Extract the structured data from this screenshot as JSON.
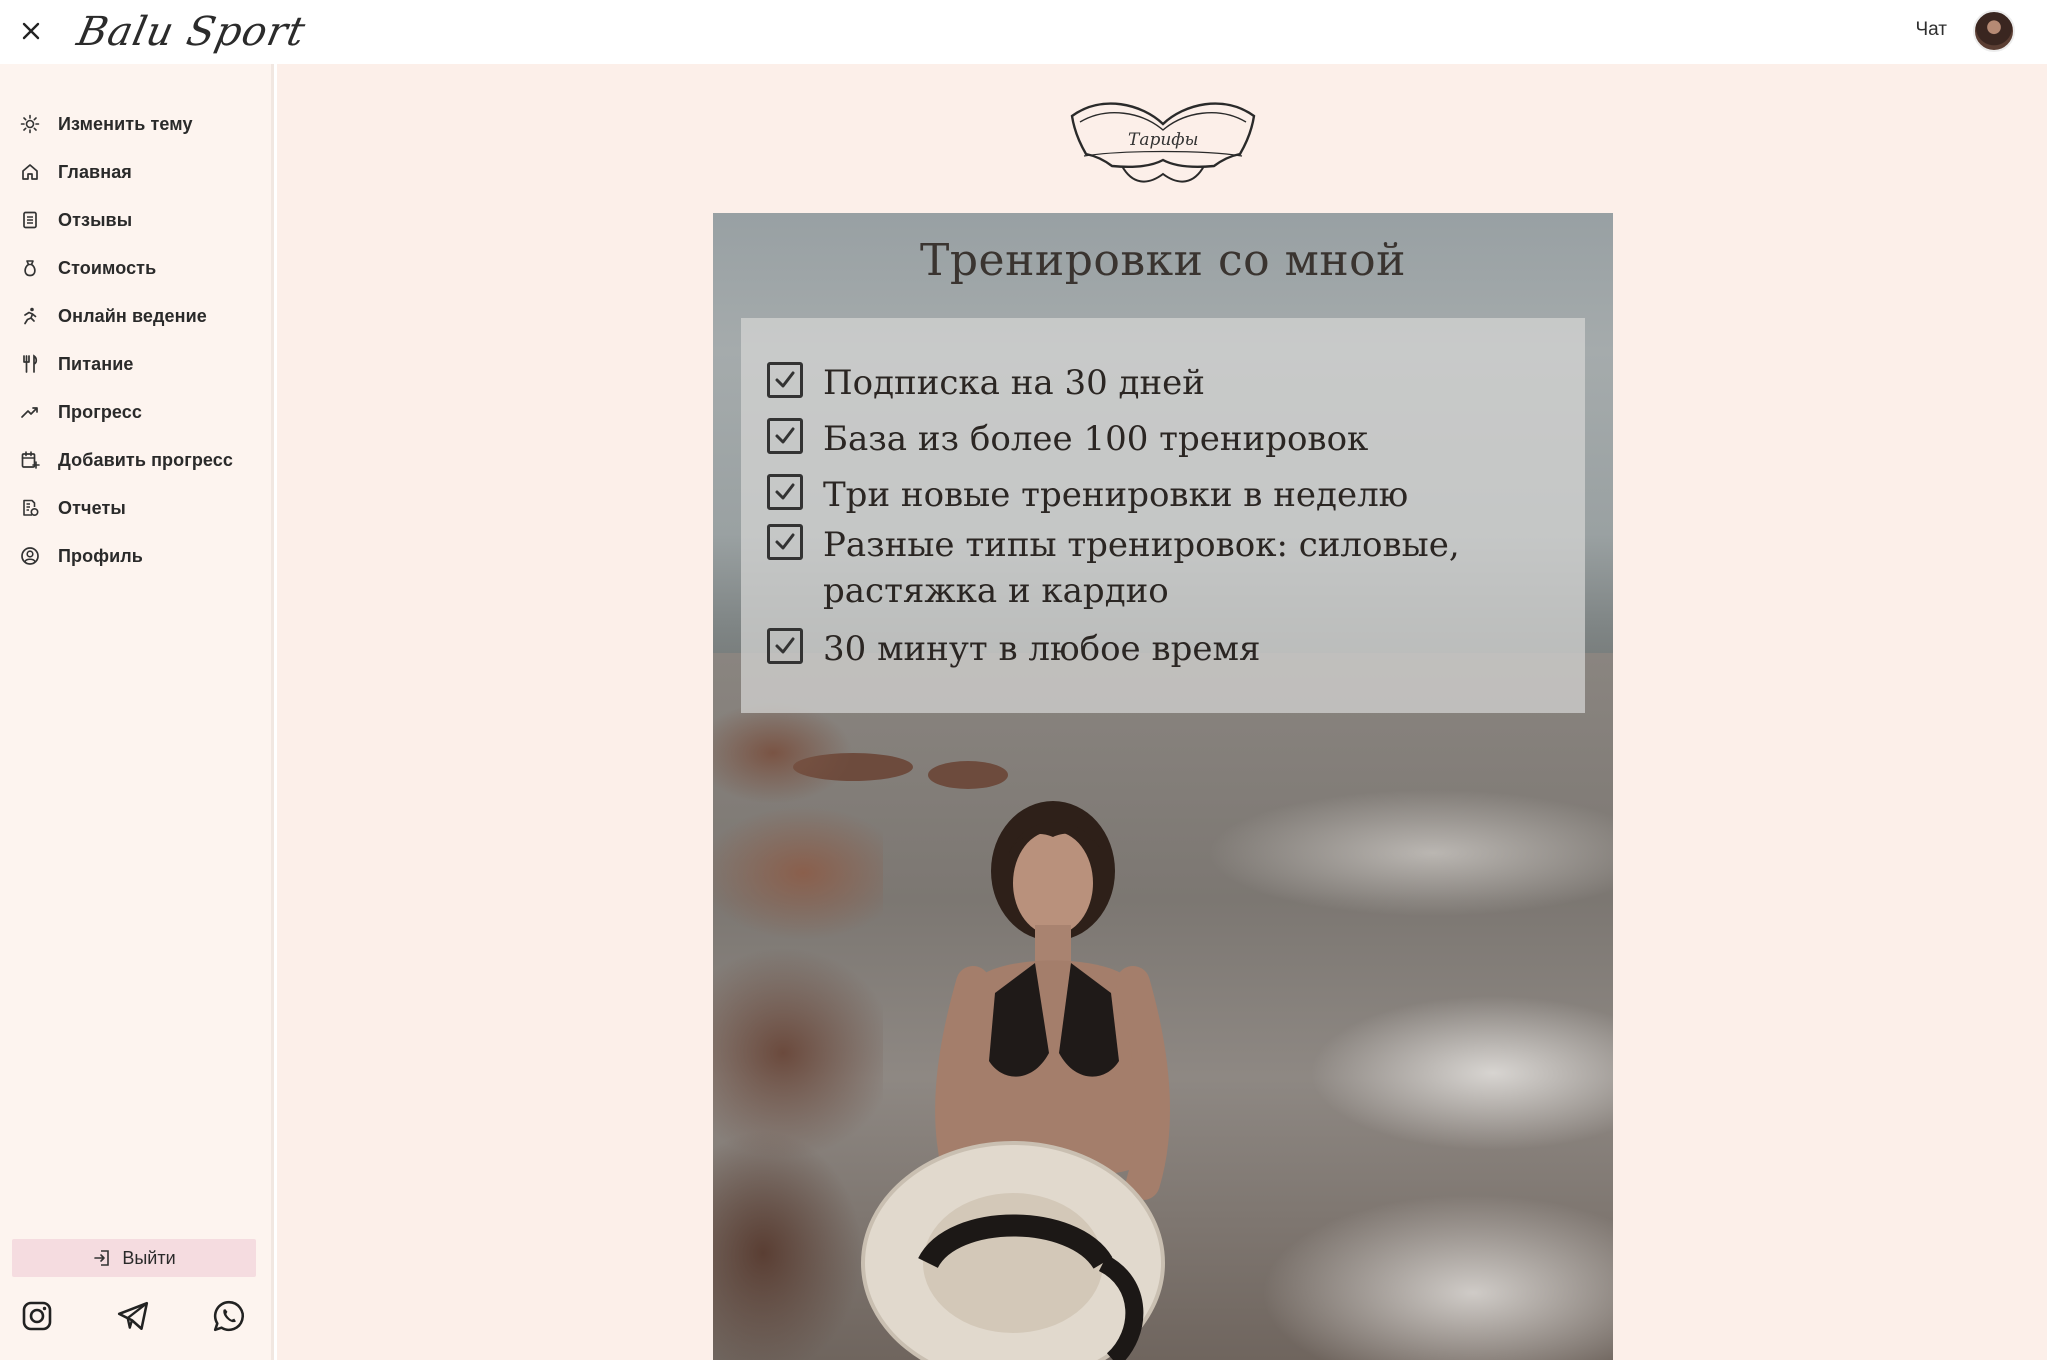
{
  "app": {
    "logo_text": "Balu Sport",
    "chat_label": "Чат"
  },
  "sidebar": {
    "items": [
      {
        "label": "Изменить тему",
        "icon": "sun-icon"
      },
      {
        "label": "Главная",
        "icon": "home-icon"
      },
      {
        "label": "Отзывы",
        "icon": "clipboard-icon"
      },
      {
        "label": "Стоимость",
        "icon": "money-bag-icon"
      },
      {
        "label": "Онлайн ведение",
        "icon": "running-icon"
      },
      {
        "label": "Питание",
        "icon": "fork-knife-icon"
      },
      {
        "label": "Прогресс",
        "icon": "trending-up-icon"
      },
      {
        "label": "Добавить прогресс",
        "icon": "calendar-add-icon"
      },
      {
        "label": "Отчеты",
        "icon": "report-icon"
      },
      {
        "label": "Профиль",
        "icon": "user-circle-icon"
      }
    ],
    "logout_label": "Выйти",
    "socials": [
      "instagram-icon",
      "telegram-icon",
      "whatsapp-icon"
    ]
  },
  "main": {
    "emblem_text": "Тарифы",
    "promo": {
      "title": "Тренировки со мной",
      "items": [
        {
          "line1": "Подписка на 30 дней",
          "line2": ""
        },
        {
          "line1": "База из более 100 тренировок",
          "line2": ""
        },
        {
          "line1": "Три новые тренировки в неделю",
          "line2": ""
        },
        {
          "line1": "Разные типы тренировок: силовые,",
          "line2": "растяжка и кардио"
        },
        {
          "line1": "30 минут в любое время",
          "line2": ""
        }
      ]
    }
  },
  "colors": {
    "sidebar_bg": "#fdf4ef",
    "main_bg": "#fcefe9",
    "logout_bg": "#f5dce0"
  }
}
